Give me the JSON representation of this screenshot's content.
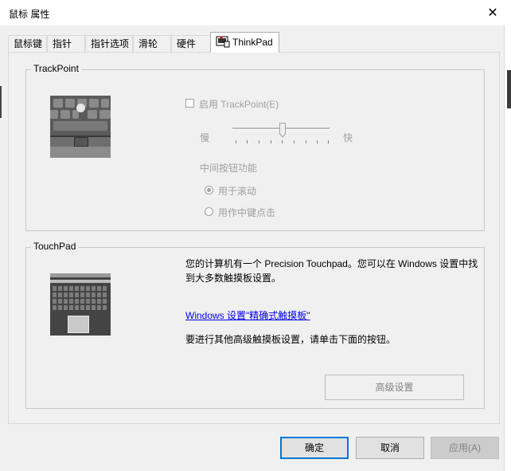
{
  "window": {
    "title": "鼠标 属性",
    "close_glyph": "✕"
  },
  "tabs": [
    {
      "label": "鼠标键"
    },
    {
      "label": "指针"
    },
    {
      "label": "指针选项"
    },
    {
      "label": "滑轮"
    },
    {
      "label": "硬件"
    },
    {
      "label": "ThinkPad",
      "active": true,
      "icon": "thinkpad-mouse-icon"
    }
  ],
  "trackpoint": {
    "group_title": "TrackPoint",
    "enable_label": "启用 TrackPoint(E)",
    "enable_checked": false,
    "speed_slow": "慢",
    "speed_fast": "快",
    "speed_value": 0.5,
    "middle_button_label": "中间按钮功能",
    "option_scroll": "用于滚动",
    "option_middle_click": "用作中键点击",
    "selected_option": "option_scroll"
  },
  "touchpad": {
    "group_title": "TouchPad",
    "description": "您的计算机有一个 Precision Touchpad。您可以在 Windows 设置中找到大多数触摸板设置。",
    "link_text": "Windows 设置\"精确式触摸板\"",
    "advanced_hint": "要进行其他高级触摸板设置，请单击下面的按钮。",
    "advanced_button": "高级设置"
  },
  "footer": {
    "ok": "确定",
    "cancel": "取消",
    "apply": "应用(A)"
  },
  "colors": {
    "accent": "#0078d7",
    "disabled_text": "#a0a0a0",
    "link": "#0000ee"
  }
}
